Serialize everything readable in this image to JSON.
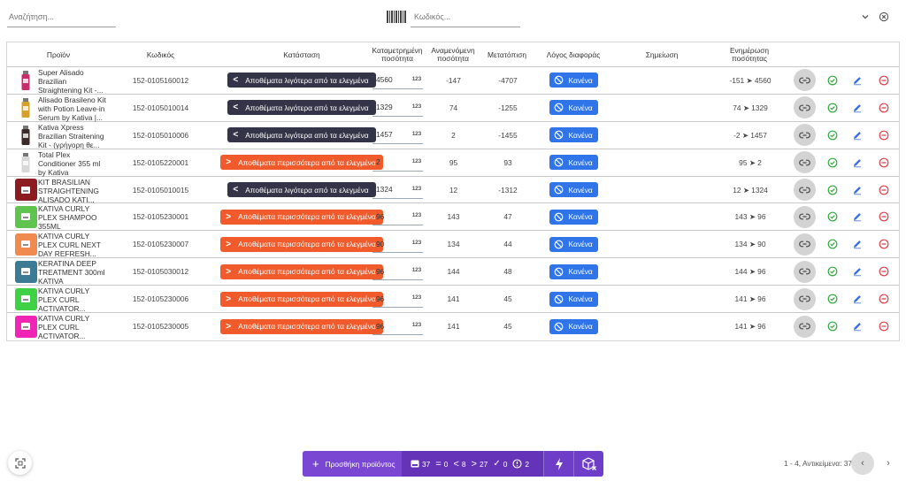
{
  "search": {
    "placeholder": "Αναζήτηση..."
  },
  "code_search": {
    "placeholder": "Κωδικός..."
  },
  "icons": {
    "barcode": "barcode-icon",
    "chevron": "chevron-down-icon",
    "close": "close-circle-icon"
  },
  "table": {
    "headers": {
      "product": "Προϊόν",
      "code": "Κωδικός",
      "status": "Κατάσταση",
      "counted": "Καταμετρημένη ποσότητα",
      "expected": "Αναμενόμενη ποσότητα",
      "shift": "Μετατόπιση",
      "reason": "Λόγος διαφοράς",
      "note": "Σημείωση",
      "update": "Ενημέρωση ποσότητας"
    },
    "rows": [
      {
        "name": "Super Alisado Brazilian Straightening Kit -...",
        "code": "152-0105160012",
        "status": "Αποθέματα λιγότερα από τα ελεγμένα",
        "status_type": "less",
        "counted": "4560",
        "expected": "-147",
        "shift": "-4707",
        "reason": "Κανένα",
        "update": "-151 ➤ 4560",
        "thumb": {
          "kind": "image",
          "color": "#c62d6b"
        }
      },
      {
        "name": "Alisado Brasileno Kit with Potion Leave-in Serum by Kativa |...",
        "code": "152-0105010014",
        "status": "Αποθέματα λιγότερα από τα ελεγμένα",
        "status_type": "less",
        "counted": "1329",
        "expected": "74",
        "shift": "-1255",
        "reason": "Κανένα",
        "update": "74 ➤ 1329",
        "thumb": {
          "kind": "image",
          "color": "#d6a02a"
        }
      },
      {
        "name": "Kativa Xpress Brazilian Straitening Kit - (γρήγορη θε...",
        "code": "152-0105010006",
        "status": "Αποθέματα λιγότερα από τα ελεγμένα",
        "status_type": "less",
        "counted": "1457",
        "expected": "2",
        "shift": "-1455",
        "reason": "Κανένα",
        "update": "-2 ➤ 1457",
        "thumb": {
          "kind": "image",
          "color": "#3a2a2a"
        }
      },
      {
        "name": "Total Plex Conditioner 355 ml by Kativa",
        "code": "152-0105220001",
        "status": "Αποθέματα περισσότερα από τα ελεγμένα",
        "status_type": "more",
        "counted": "2",
        "expected": "95",
        "shift": "93",
        "reason": "Κανένα",
        "update": "95 ➤ 2",
        "thumb": {
          "kind": "image",
          "color": "#d8d8d8"
        }
      },
      {
        "name": "KIT BRASILIAN STRAIGHTENING ALISADO KATI...",
        "code": "152-0105010015",
        "status": "Αποθέματα λιγότερα από τα ελεγμένα",
        "status_type": "less",
        "counted": "1324",
        "expected": "12",
        "shift": "-1312",
        "reason": "Κανένα",
        "update": "12 ➤ 1324",
        "thumb": {
          "kind": "box",
          "color": "#8c1c20"
        }
      },
      {
        "name": "KATIVA CURLY PLEX SHAMPOO 355ML",
        "code": "152-0105230001",
        "status": "Αποθέματα περισσότερα από τα ελεγμένα",
        "status_type": "more",
        "counted": "96",
        "expected": "143",
        "shift": "47",
        "reason": "Κανένα",
        "update": "143 ➤ 96",
        "thumb": {
          "kind": "box",
          "color": "#5fc44d"
        }
      },
      {
        "name": "KATIVA CURLY PLEX CURL NEXT DAY REFRESH...",
        "code": "152-0105230007",
        "status": "Αποθέματα περισσότερα από τα ελεγμένα",
        "status_type": "more",
        "counted": "90",
        "expected": "134",
        "shift": "44",
        "reason": "Κανένα",
        "update": "134 ➤ 90",
        "thumb": {
          "kind": "box",
          "color": "#f08a4f"
        }
      },
      {
        "name": "KERATINA DEEP TREATMENT 300ml KATIVA",
        "code": "152-0105030012",
        "status": "Αποθέματα περισσότερα από τα ελεγμένα",
        "status_type": "more",
        "counted": "96",
        "expected": "144",
        "shift": "48",
        "reason": "Κανένα",
        "update": "144 ➤ 96",
        "thumb": {
          "kind": "box",
          "color": "#3d7a93"
        }
      },
      {
        "name": "KATIVA CURLY PLEX CURL ACTIVATOR...",
        "code": "152-0105230006",
        "status": "Αποθέματα περισσότερα από τα ελεγμένα",
        "status_type": "more",
        "counted": "96",
        "expected": "141",
        "shift": "45",
        "reason": "Κανένα",
        "update": "141 ➤ 96",
        "thumb": {
          "kind": "box",
          "color": "#3ed145"
        }
      },
      {
        "name": "KATIVA CURLY PLEX CURL ACTIVATOR...",
        "code": "152-0105230005",
        "status": "Αποθέματα περισσότερα από τα ελεγμένα",
        "status_type": "more",
        "counted": "96",
        "expected": "141",
        "shift": "45",
        "reason": "Κανένα",
        "update": "141 ➤ 96",
        "thumb": {
          "kind": "box",
          "color": "#f025b5"
        }
      }
    ]
  },
  "counted_icon_label": "123",
  "row_actions": [
    "link-icon",
    "check-circle-icon",
    "pencil-icon",
    "remove-circle-icon"
  ],
  "bottom_bar": {
    "add_label": "Προσθήκη προϊόντος",
    "stats": [
      {
        "icon": "product-icon",
        "value": "37"
      },
      {
        "icon": "equal-icon",
        "value": "0"
      },
      {
        "icon": "less-than-icon",
        "value": "8"
      },
      {
        "icon": "greater-than-icon",
        "value": "27"
      },
      {
        "icon": "check-icon",
        "value": "0"
      },
      {
        "icon": "alert-clock-icon",
        "value": "2"
      }
    ],
    "icons": [
      "lightning-icon",
      "box-x-icon"
    ]
  },
  "pager": {
    "text": "1 - 4, Αντικείμενα: 37"
  },
  "colors": {
    "less": "#333448",
    "more": "#f15a2b",
    "reason": "#2f74e8",
    "accent": "#6f3ec8",
    "ok": "#2eaa3a",
    "edit": "#3a6ee8",
    "delete": "#e0404a"
  }
}
